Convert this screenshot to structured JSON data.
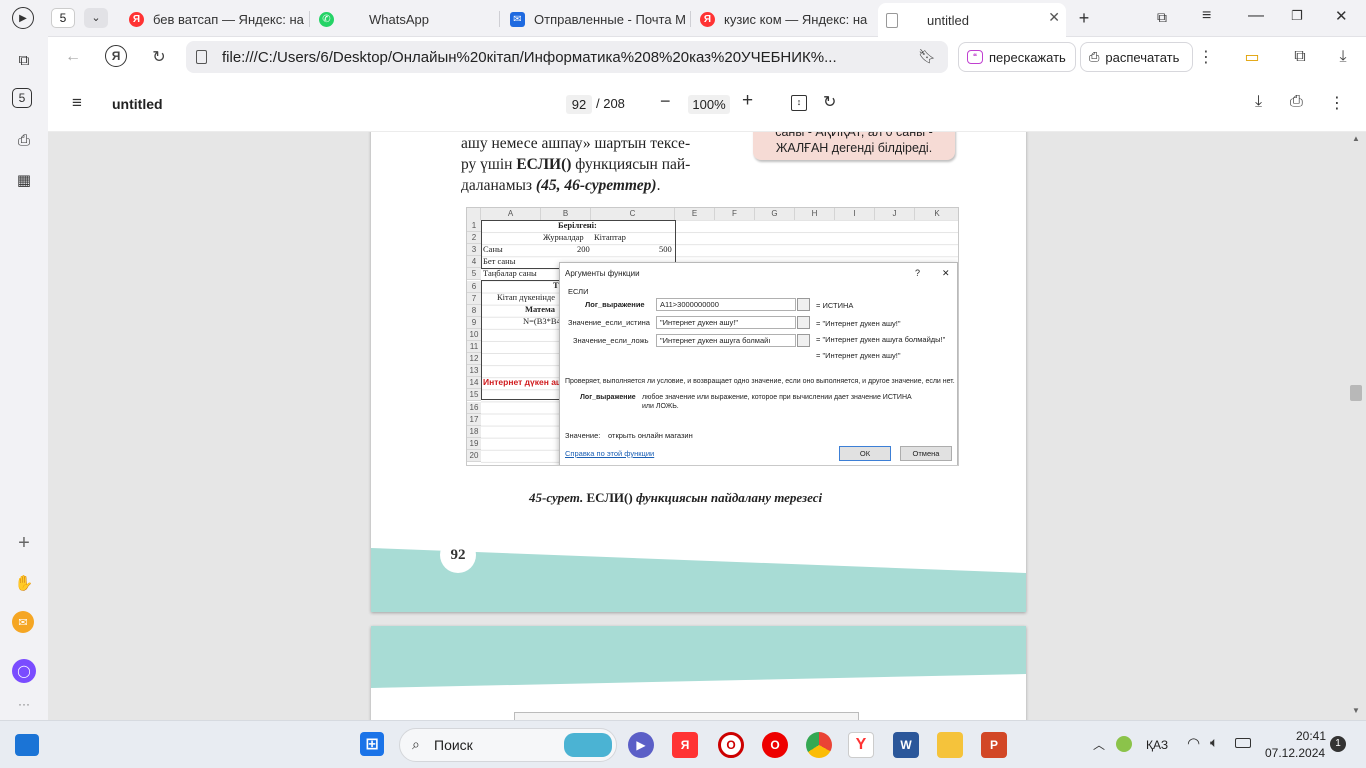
{
  "tabs": [
    {
      "label": "5",
      "kind": "counter"
    },
    {
      "label": "бев ватсап — Яндекс: на",
      "favicon": "yandex-icon"
    },
    {
      "label": "WhatsApp",
      "favicon": "whatsapp-icon"
    },
    {
      "label": "Отправленные - Почта M",
      "favicon": "mail-icon"
    },
    {
      "label": "кузис ком — Яндекс: на",
      "favicon": "yandex-icon"
    },
    {
      "label": "untitled",
      "favicon": "pdf-file-icon",
      "active": true
    }
  ],
  "address_bar": {
    "url": "file:///C:/Users/6/Desktop/Онлайын%20кітап/Информатика%208%20каз%20УЧЕБНИК%..."
  },
  "toolbar_actions": {
    "retell": "перескажать",
    "print": "распечатать"
  },
  "sidebar": {
    "counter": "5"
  },
  "pdf": {
    "title": "untitled",
    "current_page": "92",
    "total_pages": "/ 208",
    "zoom": "100%"
  },
  "book": {
    "line1": "ашу немесе ашпау» шартын тексе-",
    "line2_pre": "ру үшін ",
    "line2_bold": "ЕСЛИ()",
    "line2_post": " функциясын пай-",
    "line3_pre": "даланамыз ",
    "line3_italic": "(45, 46-суреттер)",
    "line3_post": ".",
    "note_line1": "саны - АҚИҚАТ, ал 0 саны -",
    "note_line2": "ЖАЛҒАН дегенді білдіреді.",
    "caption_italic": "45-сурет.",
    "caption_main": " ЕСЛИ() ",
    "caption_rest": "функциясын пайдалану терезесі",
    "page_number": "92"
  },
  "excel": {
    "columns": [
      "A",
      "B",
      "C",
      "E",
      "F",
      "G",
      "H",
      "I",
      "J",
      "K"
    ],
    "rows": [
      "1",
      "2",
      "3",
      "4",
      "5",
      "6",
      "7",
      "8",
      "9",
      "10",
      "11",
      "12",
      "13",
      "14",
      "15",
      "16",
      "17",
      "18",
      "19",
      "20"
    ],
    "cells": {
      "given": "Берілгені:",
      "journals": "Журналдар",
      "books": "Кітаптар",
      "count": "Саны",
      "b3": "200",
      "c3": "500",
      "page_count": "Бет саны",
      "chosen_count": "Таңбалар саны",
      "r6": "Т",
      "r7": "Кітап дүкенінде",
      "r8": "Матема",
      "r9": "N=(B3*B4",
      "r14": "Интернет дүкен ашу"
    }
  },
  "dialog": {
    "title": "Аргументы функции",
    "help_q": "?",
    "close": "✕",
    "func": "ЕСЛИ",
    "arg1_label": "Лог_выражение",
    "arg1_value": "A11>3000000000",
    "arg1_result": "= ИСТИНА",
    "arg2_label": "Значение_если_истина",
    "arg2_value": "\"Интернет дукен ашу!\"",
    "arg2_result": "= \"Интернет дукен ашу!\"",
    "arg3_label": "Значение_если_ложь",
    "arg3_value": "\"Интернет дукен ашуга болмайı",
    "arg3_result": "= \"Интернет дукен ашуга болмайды!\"",
    "total_result": "= \"Интернет дукен ашу!\"",
    "description": "Проверяет, выполняется ли условие, и возвращает одно значение, если оно выполняется, и другое значение, если нет.",
    "arg_desc_label": "Лог_выражение",
    "arg_desc_line1": "любое значение или выражение, которое при вычислении дает значение ИСТИНА",
    "arg_desc_line2": "или ЛОЖЬ.",
    "value_label": "Значение:",
    "value_text": "открыть онлайн магазин",
    "help_link": "Справка по этой функции",
    "ok": "ОК",
    "cancel": "Отмена"
  },
  "taskbar": {
    "search_placeholder": "Поиск",
    "lang": "ҚАЗ",
    "time": "20:41",
    "date": "07.12.2024",
    "notifications": "1"
  },
  "colors": {
    "teal_band": "#a8dcd5",
    "note_bg": "#f6dbd5",
    "excel_red_text": "#d0191c",
    "link_blue": "#1a5fb4"
  }
}
